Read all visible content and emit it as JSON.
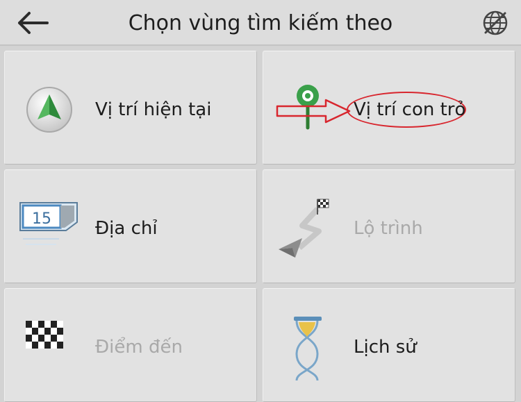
{
  "header": {
    "title": "Chọn vùng tìm kiếm theo",
    "back_icon": "arrow-left-icon",
    "globe_icon": "globe-off-icon"
  },
  "tiles": [
    {
      "label": "Vị trí hiện tại",
      "icon": "green-arrow-location-icon",
      "enabled": true
    },
    {
      "label": "Vị trí con trỏ",
      "icon": "green-pin-icon",
      "enabled": true
    },
    {
      "label": "Địa chỉ",
      "icon": "address-sign-15-icon",
      "enabled": true,
      "icon_text": "15"
    },
    {
      "label": "Lộ trình",
      "icon": "route-icon",
      "enabled": false
    },
    {
      "label": "Điểm đến",
      "icon": "checkered-flag-icon",
      "enabled": false
    },
    {
      "label": "Lịch sử",
      "icon": "hourglass-icon",
      "enabled": true
    }
  ],
  "colors": {
    "background": "#d3d3d3",
    "tile": "#e2e2e2",
    "annotation_red": "#d8262e",
    "accent_green": "#3aa04a"
  }
}
